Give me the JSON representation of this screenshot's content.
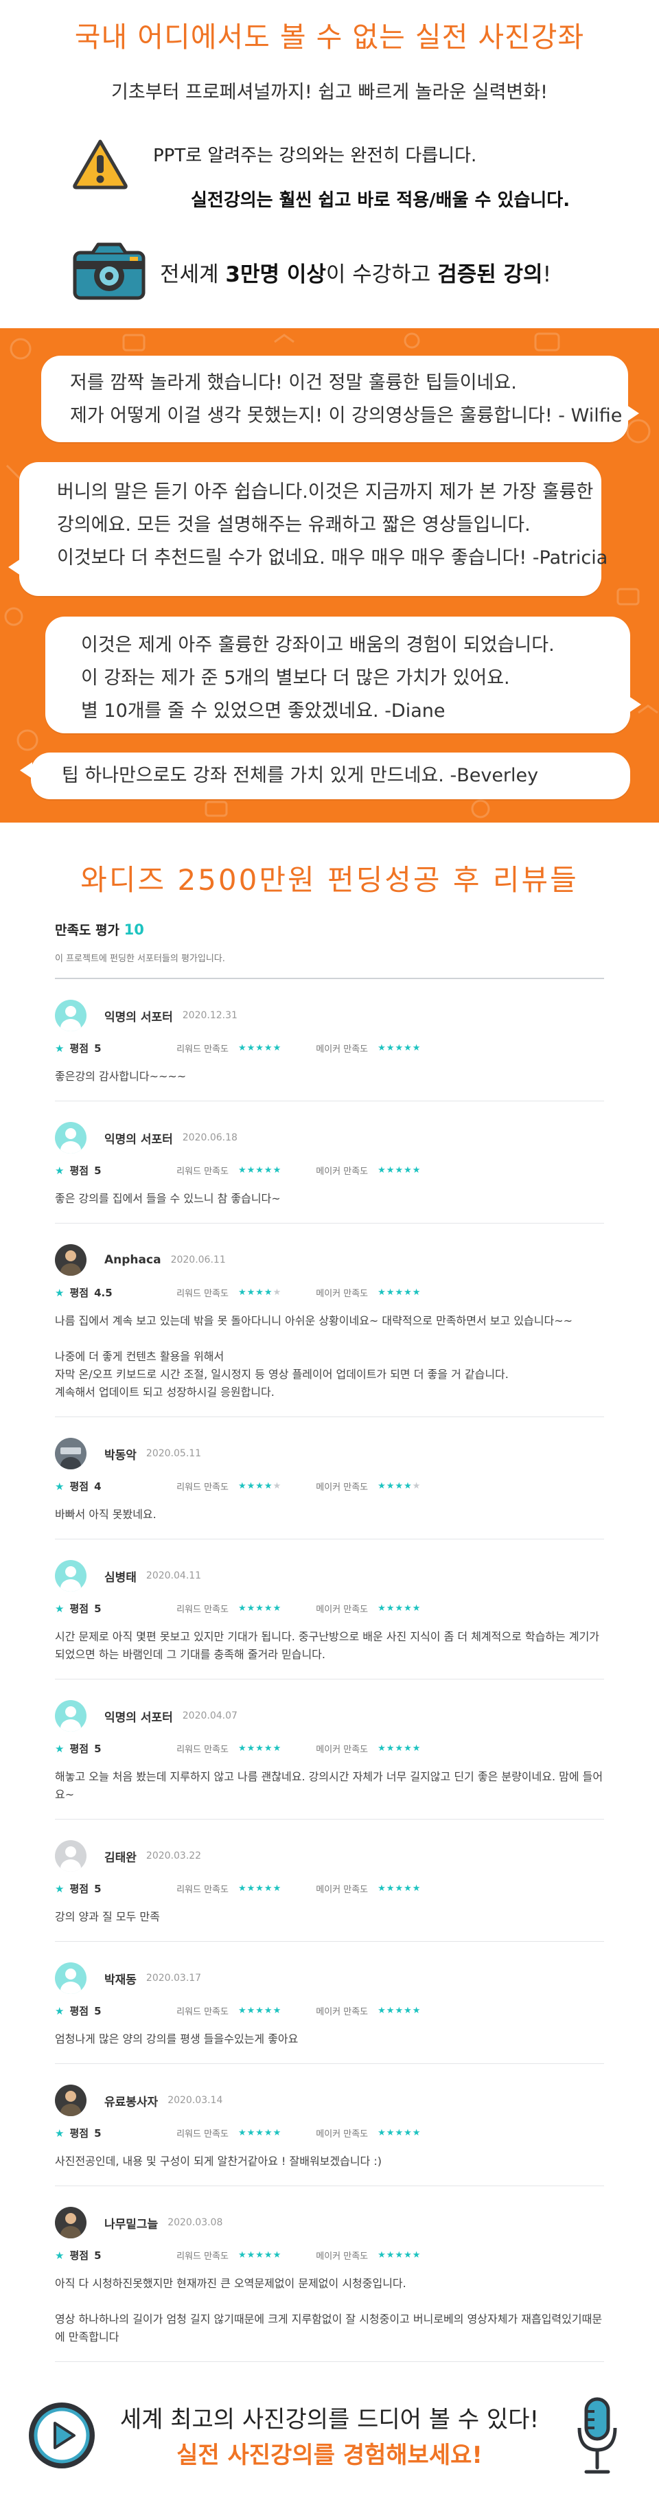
{
  "intro": {
    "title": "국내 어디에서도 볼 수 없는 실전 사진강좌",
    "subtitle": "기초부터 프로페셔널까지! 쉽고 빠르게 놀라운 실력변화!",
    "warning_line1": "PPT로 알려주는 강의와는 완전히 다릅니다.",
    "warning_line2": "실전강의는 훨씬 쉽고 바로 적용/배울 수 있습니다.",
    "camera_pre": "전세계 ",
    "camera_b1": "3만명 이상",
    "camera_mid": "이 수강하고 ",
    "camera_b2": "검증된 강의",
    "camera_post": "!"
  },
  "testimonials": {
    "t1_line1": "저를 깜짝 놀라게 했습니다! 이건 정말 훌륭한 팁들이네요.",
    "t1_line2": "제가 어떻게 이걸 생각 못했는지! 이 강의영상들은 훌륭합니다! - Wilfie",
    "t2_line1": "버니의 말은 듣기 아주 쉽습니다.이것은 지금까지 제가 본 가장 훌륭한",
    "t2_line2": "강의에요. 모든 것을 설명해주는 유쾌하고 짧은 영상들입니다.",
    "t2_line3": "이것보다 더 추천드릴 수가 없네요. 매우 매우 매우 좋습니다! -Patricia",
    "t3_line1": "이것은 제게 아주 훌륭한 강좌이고 배움의 경험이 되었습니다.",
    "t3_line2": "이 강좌는 제가 준 5개의 별보다 더 많은 가치가 있어요.",
    "t3_line3": "별 10개를 줄 수 있었으면 좋았겠네요. -Diane",
    "t4_line1": "팁 하나만으로도 강좌 전체를 가치 있게 만드네요. -Beverley"
  },
  "wadiz": {
    "heading": "와디즈 2500만원 펀딩성공 후 리뷰들"
  },
  "reviews_header": {
    "title": "만족도 평가",
    "count": "10",
    "desc": "이 프로젝트에 펀딩한 서포터들의 평가입니다."
  },
  "labels": {
    "rating": "평점",
    "reward": "리워드 만족도",
    "maker": "메이커 만족도"
  },
  "reviews": [
    {
      "name": "익명의 서포터",
      "date": "2020.12.31",
      "rating": "5",
      "reward": 5,
      "maker": 5,
      "avatar": "default",
      "body": "좋은강의 감사합니다~~~~"
    },
    {
      "name": "익명의 서포터",
      "date": "2020.06.18",
      "rating": "5",
      "reward": 5,
      "maker": 5,
      "avatar": "default",
      "body": "좋은 강의를 집에서 들을 수 있느니 참 좋습니다~"
    },
    {
      "name": "Anphaca",
      "date": "2020.06.11",
      "rating": "4.5",
      "reward": 4,
      "maker": 5,
      "avatar": "photo",
      "body": "나름 집에서 계속 보고 있는데 밖을 못 돌아다니니 아쉬운 상황이네요~ 대략적으로 만족하면서 보고 있습니다~~\n\n나중에 더 좋게 컨텐츠 활용을 위해서\n자막 온/오프 키보드로 시간 조절, 일시정지 등 영상 플레이어 업데이트가 되면 더 좋을 거 같습니다.\n계속해서 업데이트 되고 성장하시길 응원합니다."
    },
    {
      "name": "박동악",
      "date": "2020.05.11",
      "rating": "4",
      "reward": 4,
      "maker": 4,
      "avatar": "scene",
      "body": "바빠서 아직 못봤네요."
    },
    {
      "name": "심병태",
      "date": "2020.04.11",
      "rating": "5",
      "reward": 5,
      "maker": 5,
      "avatar": "default",
      "body": "시간 문제로 아직 몇편 못보고 있지만 기대가 됩니다. 중구난방으로 배운 사진 지식이 좀 더 체계적으로 학습하는 계기가 되었으면 하는 바램인데 그 기대를 충족해 줄거라 믿습니다."
    },
    {
      "name": "익명의 서포터",
      "date": "2020.04.07",
      "rating": "5",
      "reward": 5,
      "maker": 5,
      "avatar": "default",
      "body": "해놓고 오늘 처음 봤는데 지루하지 않고 나름 괜찮네요. 강의시간 자체가 너무 길지않고 딘기 좋은 분량이네요. 맘에 들어요~"
    },
    {
      "name": "김태완",
      "date": "2020.03.22",
      "rating": "5",
      "reward": 5,
      "maker": 5,
      "avatar": "grey",
      "body": "강의 양과 질 모두 만족"
    },
    {
      "name": "박재동",
      "date": "2020.03.17",
      "rating": "5",
      "reward": 5,
      "maker": 5,
      "avatar": "default",
      "body": "엄청나게 많은 양의 강의를 평생 들을수있는게 좋아요"
    },
    {
      "name": "유료봉사자",
      "date": "2020.03.14",
      "rating": "5",
      "reward": 5,
      "maker": 5,
      "avatar": "photo",
      "body": "사진전공인데, 내용 및 구성이 되게 알찬거같아요 ! 잘배워보겠습니다 :)"
    },
    {
      "name": "나무밑그늘",
      "date": "2020.03.08",
      "rating": "5",
      "reward": 5,
      "maker": 5,
      "avatar": "photo",
      "body": "아직 다 시청하진못했지만 현재까진 큰 오역문제없이 문제없이 시청중입니다.\n\n영상 하나하나의 길이가 엄청 길지 않기때문에 크게 지루함없이 잘 시청중이고 버니로베의 영상자체가 재흡입력있기때문에 만족합니다"
    }
  ],
  "bottom": {
    "line1": "세계 최고의 사진강의를 드디어 볼 수 있다!",
    "line2": "실전 사진강의를 경험해보세요!"
  },
  "colors": {
    "accent_orange": "#f07424",
    "band_orange": "#f57b1e",
    "teal": "#1dc3c0"
  },
  "icons": [
    "warning-icon",
    "camera-icon",
    "play-icon",
    "microphone-icon",
    "star-icon",
    "avatar-icon"
  ]
}
